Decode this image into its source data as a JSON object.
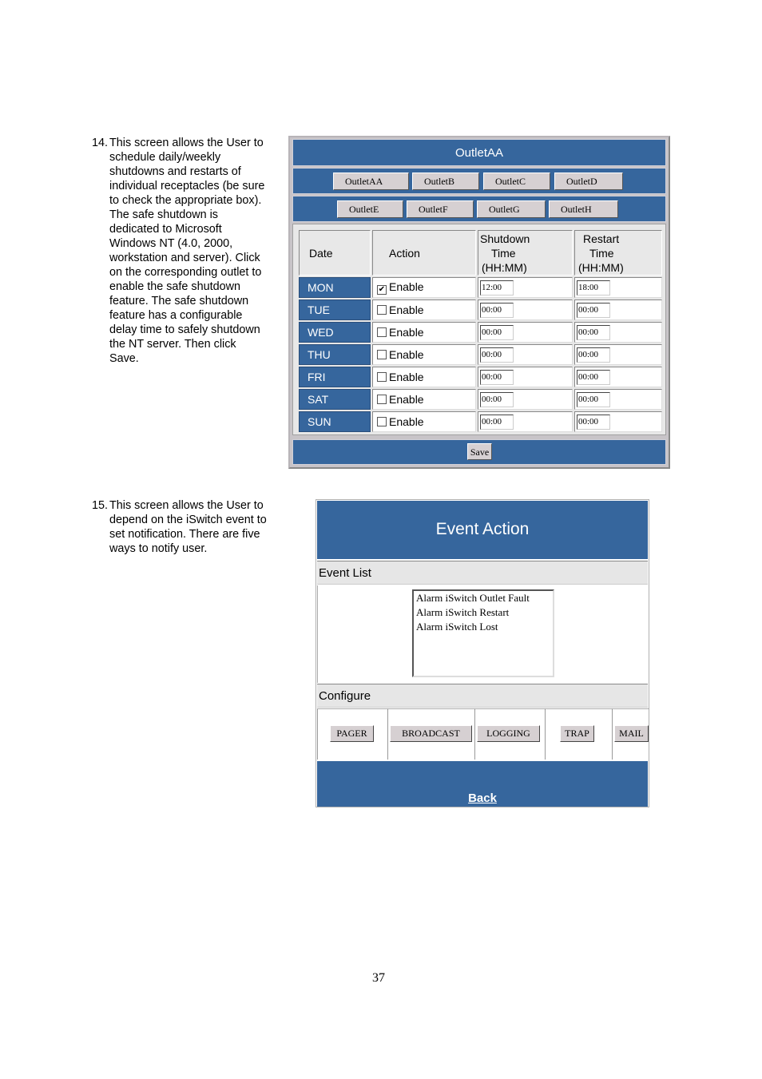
{
  "step14": {
    "number": "14.",
    "lines": [
      "This screen allows the User to",
      "schedule daily/weekly",
      "shutdowns and restarts of",
      "individual receptacles (be sure",
      "to check the appropriate box).",
      "The safe shutdown is",
      "dedicated to Microsoft",
      "Windows NT (4.0, 2000,",
      "workstation and server).  Click",
      "on the corresponding outlet to",
      "enable the safe shutdown",
      "feature.  The safe shutdown",
      "feature has a configurable",
      "delay time to safely shutdown",
      "the NT server.  Then click",
      "Save."
    ]
  },
  "schedule_panel": {
    "title": "OutletAA",
    "outlet_buttons_row1": [
      "OutletAA",
      "OutletB",
      "OutletC",
      "OutletD"
    ],
    "outlet_buttons_row2": [
      "OutletE",
      "OutletF",
      "OutletG",
      "OutletH"
    ],
    "headers": {
      "date": "Date",
      "action": "Action",
      "shutdown": [
        "Shutdown",
        "Time",
        "(HH:MM)"
      ],
      "restart": [
        "Restart",
        "Time",
        "(HH:MM)"
      ]
    },
    "rows": [
      {
        "day": "MON",
        "enabled": true,
        "action_label": "Enable",
        "shutdown": "12:00",
        "restart": "18:00"
      },
      {
        "day": "TUE",
        "enabled": false,
        "action_label": "Enable",
        "shutdown": "00:00",
        "restart": "00:00"
      },
      {
        "day": "WED",
        "enabled": false,
        "action_label": "Enable",
        "shutdown": "00:00",
        "restart": "00:00"
      },
      {
        "day": "THU",
        "enabled": false,
        "action_label": "Enable",
        "shutdown": "00:00",
        "restart": "00:00"
      },
      {
        "day": "FRI",
        "enabled": false,
        "action_label": "Enable",
        "shutdown": "00:00",
        "restart": "00:00"
      },
      {
        "day": "SAT",
        "enabled": false,
        "action_label": "Enable",
        "shutdown": "00:00",
        "restart": "00:00"
      },
      {
        "day": "SUN",
        "enabled": false,
        "action_label": "Enable",
        "shutdown": "00:00",
        "restart": "00:00"
      }
    ],
    "save_label": "Save",
    "checkmark_glyph": "✔"
  },
  "step15": {
    "number": "15.",
    "lines": [
      "This screen allows the User to",
      "depend on the iSwitch event to",
      "set notification. There are five",
      "ways to notify user."
    ]
  },
  "event_panel": {
    "title": "Event Action",
    "event_list_label": "Event List",
    "events": [
      "Alarm iSwitch Outlet Fault",
      "Alarm iSwitch Restart",
      "Alarm iSwitch Lost"
    ],
    "configure_label": "Configure",
    "buttons": [
      "PAGER",
      "BROADCAST",
      "LOGGING",
      "TRAP",
      "MAIL"
    ],
    "back_label": "Back"
  },
  "page_number": "37",
  "colors": {
    "panel_blue": "#36669d",
    "section_gray": "#e6e6e6",
    "button_face": "#d6d0d2"
  }
}
